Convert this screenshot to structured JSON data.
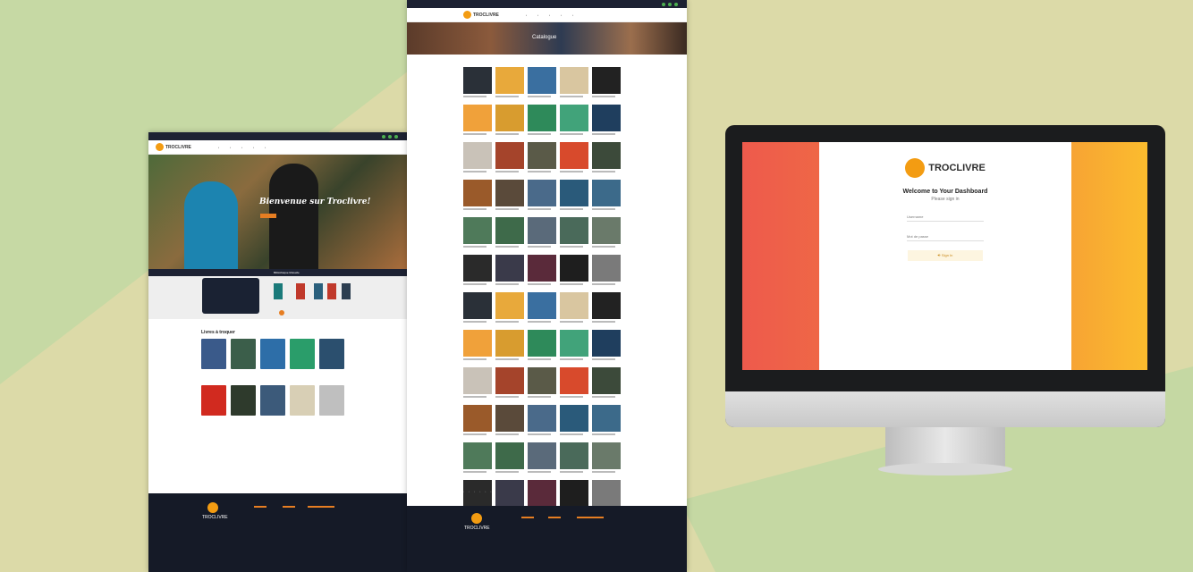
{
  "page1": {
    "brand": "TROCLIVRE",
    "hero_title": "Bienvenue sur Troclivre!",
    "bib_bar": "Bibliothèque Mutuelle",
    "section_title": "Livres à troquer",
    "footer_brand": "TROCLIVRE"
  },
  "page2": {
    "brand": "TROCLIVRE",
    "hero_title": "Catalogue",
    "footer_brand": "TROCLIVRE"
  },
  "dashboard": {
    "brand": "TROCLIVRE",
    "welcome": "Welcome to Your Dashboard",
    "subtitle": "Please sign in",
    "username_placeholder": "Username",
    "password_placeholder": "Mot de passe",
    "signin_button": "Sign In"
  },
  "colors": {
    "accent": "#f39c12",
    "dark": "#1d2233"
  }
}
